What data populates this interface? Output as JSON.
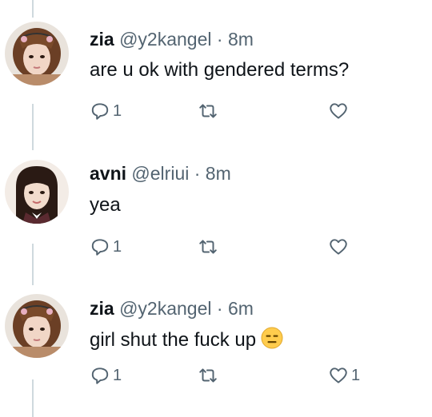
{
  "tweets": [
    {
      "name": "zia",
      "handle": "@y2kangel",
      "separator": "·",
      "time": "8m",
      "text": "are u ok with gendered terms?",
      "emoji": "",
      "reply_count": "1",
      "retweet_count": "",
      "like_count": "",
      "avatar": "photo-avatar-girl-with-headband"
    },
    {
      "name": "avni",
      "handle": "@elriui",
      "separator": "·",
      "time": "8m",
      "text": "yea",
      "emoji": "",
      "reply_count": "1",
      "retweet_count": "",
      "like_count": "",
      "avatar": "photo-avatar-girl-long-hair"
    },
    {
      "name": "zia",
      "handle": "@y2kangel",
      "separator": "·",
      "time": "6m",
      "text": "girl shut the fuck up",
      "emoji": "expressionless-face-emoji",
      "reply_count": "1",
      "retweet_count": "",
      "like_count": "1",
      "avatar": "photo-avatar-girl-with-headband"
    }
  ],
  "colors": {
    "text_primary": "#0f1419",
    "text_secondary": "#536471",
    "thread_line": "#cfd9de",
    "background": "#ffffff"
  }
}
